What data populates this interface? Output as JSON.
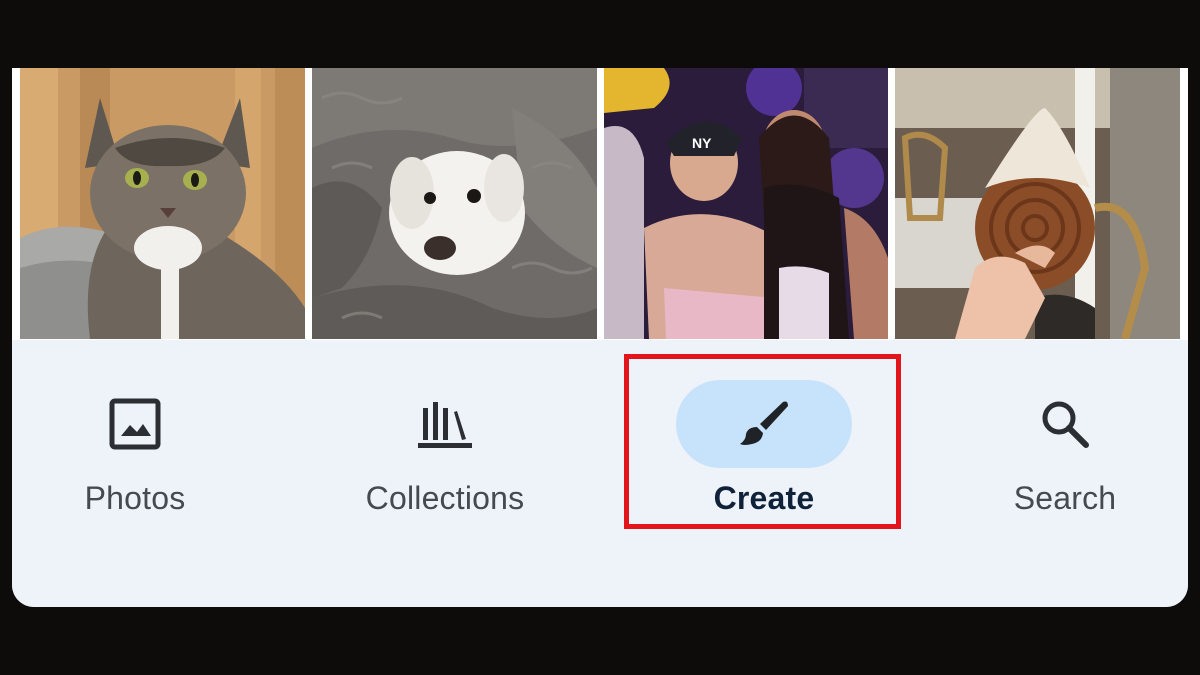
{
  "photos": [
    {
      "subject": "tabby-cat"
    },
    {
      "subject": "white-dog-in-blanket"
    },
    {
      "subject": "friends-at-party"
    },
    {
      "subject": "croissant-pastry"
    }
  ],
  "nav": {
    "items": [
      {
        "label": "Photos",
        "icon": "photo-icon",
        "active": false
      },
      {
        "label": "Collections",
        "icon": "collections-icon",
        "active": false
      },
      {
        "label": "Create",
        "icon": "paintbrush-icon",
        "active": true
      },
      {
        "label": "Search",
        "icon": "search-icon",
        "active": false
      }
    ]
  },
  "colors": {
    "nav_background": "#eef2f9",
    "active_pill": "#c6e3fb",
    "highlight_border": "#e3141b",
    "label_text": "#454a50",
    "active_label_text": "#10213a"
  }
}
